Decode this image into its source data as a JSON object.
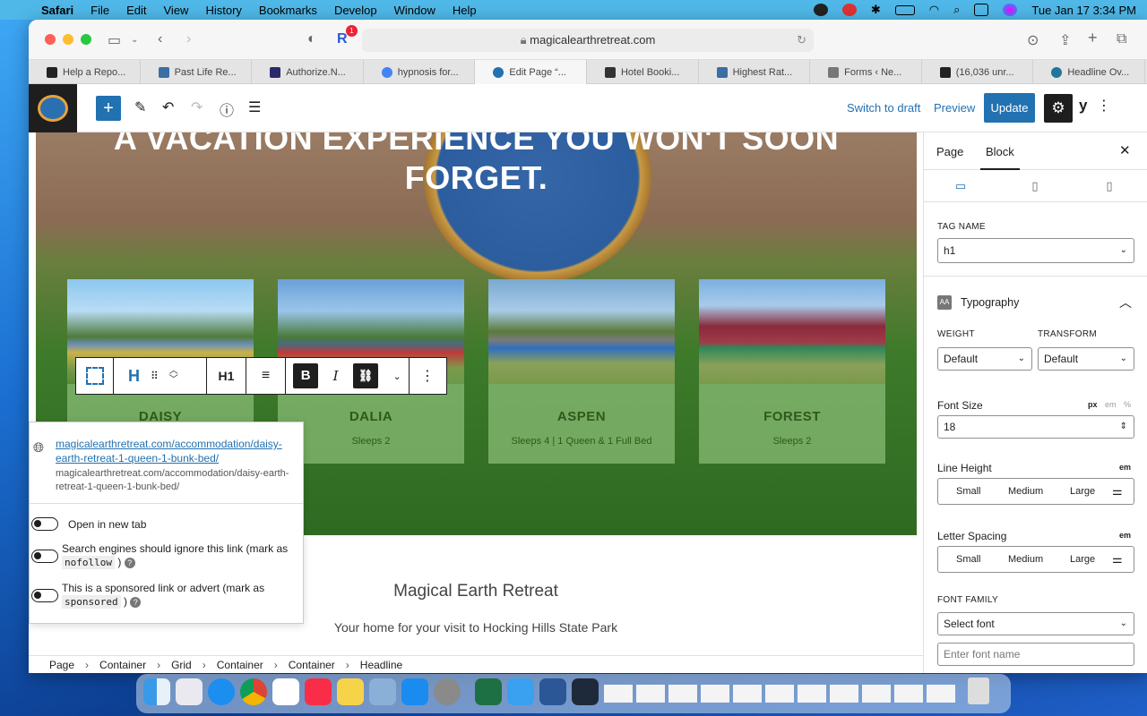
{
  "menubar": {
    "app": "Safari",
    "items": [
      "File",
      "Edit",
      "View",
      "History",
      "Bookmarks",
      "Develop",
      "Window",
      "Help"
    ],
    "datetime": "Tue Jan 17  3:34 PM"
  },
  "browser": {
    "url": "magicalearthretreat.com",
    "badge": "1",
    "tabs": [
      {
        "label": "Help a Repo...",
        "color": "#222222"
      },
      {
        "label": "Past Life Re...",
        "color": "#3a6ea5"
      },
      {
        "label": "Authorize.N...",
        "color": "#2a2a6a"
      },
      {
        "label": "hypnosis for...",
        "color": "#4285f4"
      },
      {
        "label": "Edit Page “...",
        "color": "#2271b1"
      },
      {
        "label": "Hotel Booki...",
        "color": "#333333"
      },
      {
        "label": "Highest Rat...",
        "color": "#3a6ea5"
      },
      {
        "label": "Forms ‹ Ne...",
        "color": "#777777"
      },
      {
        "label": "(16,036 unr...",
        "color": "#222222"
      },
      {
        "label": "Headline Ov...",
        "color": "#21759b"
      }
    ]
  },
  "wp": {
    "switch_draft": "Switch to draft",
    "preview": "Preview",
    "update": "Update",
    "h1_label": "H1"
  },
  "hero": {
    "line1": "A VACATION EXPERIENCE YOU WON'T SOON",
    "line2": "FORGET."
  },
  "cards": [
    {
      "name": "DAISY",
      "sleeps": "",
      "c1": "#6a8fb8",
      "c2": "#c9b14a"
    },
    {
      "name": "DALIA",
      "sleeps": "Sleeps 2",
      "c1": "#6aa0d8",
      "c2": "#c0393b"
    },
    {
      "name": "ASPEN",
      "sleeps": "Sleeps 4 | 1 Queen & 1 Full Bed",
      "c1": "#7aa8d0",
      "c2": "#2f6fc0"
    },
    {
      "name": "FOREST",
      "sleeps": "Sleeps 2",
      "c1": "#7ab0e0",
      "c2": "#8a2a3a"
    }
  ],
  "link_popover": {
    "url": "magicalearthretreat.com/accommodation/daisy-earth-retreat-1-queen-1-bunk-bed/",
    "url_plain": "magicalearthretreat.com/accommodation/daisy-earth-retreat-1-queen-1-bunk-bed/",
    "open_new_tab": "Open in new tab",
    "nofollow_text": "Search engines should ignore this link (mark as",
    "nofollow_code": "nofollow",
    "sponsored_text": "This is a sponsored link or advert (mark as",
    "sponsored_code": "sponsored",
    "close_paren": ")"
  },
  "site": {
    "title": "Magical Earth Retreat",
    "subtitle": "Your home for your visit to Hocking Hills State Park"
  },
  "breadcrumbs": [
    "Page",
    "Container",
    "Grid",
    "Container",
    "Container",
    "Headline"
  ],
  "sidebar": {
    "tab_page": "Page",
    "tab_block": "Block",
    "tag_name_label": "TAG NAME",
    "tag_name_value": "h1",
    "typography": "Typography",
    "weight_label": "WEIGHT",
    "weight_value": "Default",
    "transform_label": "TRANSFORM",
    "transform_value": "Default",
    "font_size_label": "Font Size",
    "font_size_value": "18",
    "units": {
      "px": "px",
      "em": "em",
      "pct": "%"
    },
    "line_height_label": "Line Height",
    "line_height_unit": "em",
    "letter_spacing_label": "Letter Spacing",
    "letter_spacing_unit": "em",
    "small": "Small",
    "medium": "Medium",
    "large": "Large",
    "font_family_label": "FONT FAMILY",
    "font_family_value": "Select font",
    "font_name_placeholder": "Enter font name"
  }
}
